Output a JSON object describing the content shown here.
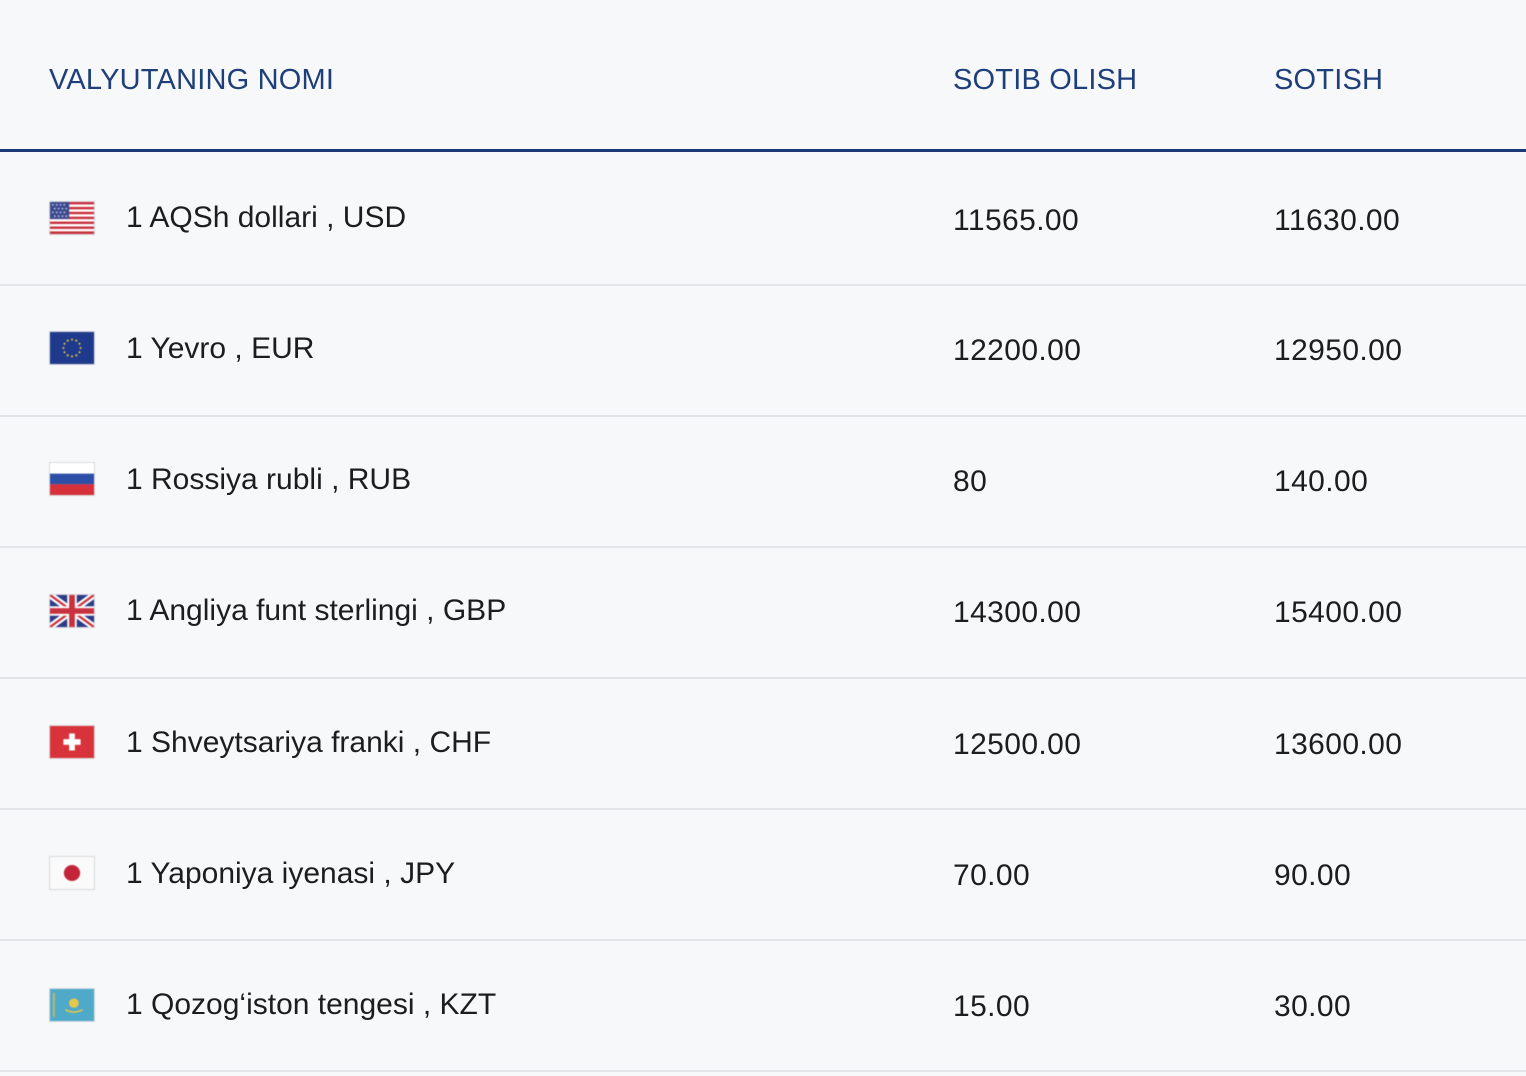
{
  "table": {
    "headers": {
      "name": "VALYUTANING NOMI",
      "buy": "SOTIB OLISH",
      "sell": "SOTISH"
    },
    "rows": [
      {
        "flag_icon": "usa-flag-icon",
        "name": "1 AQSh dollari , USD",
        "buy": "11565.00",
        "sell": "11630.00"
      },
      {
        "flag_icon": "eu-flag-icon",
        "name": "1 Yevro , EUR",
        "buy": "12200.00",
        "sell": "12950.00"
      },
      {
        "flag_icon": "russia-flag-icon",
        "name": "1 Rossiya rubli , RUB",
        "buy": "80",
        "sell": "140.00"
      },
      {
        "flag_icon": "uk-flag-icon",
        "name": "1 Angliya funt sterlingi , GBP",
        "buy": "14300.00",
        "sell": "15400.00"
      },
      {
        "flag_icon": "switzerland-flag-icon",
        "name": "1 Shveytsariya franki , CHF",
        "buy": "12500.00",
        "sell": "13600.00"
      },
      {
        "flag_icon": "japan-flag-icon",
        "name": "1 Yaponiya iyenasi , JPY",
        "buy": "70.00",
        "sell": "90.00"
      },
      {
        "flag_icon": "kazakhstan-flag-icon",
        "name": "1 Qozog‘iston tengesi , KZT",
        "buy": "15.00",
        "sell": "30.00"
      }
    ]
  },
  "colors": {
    "header_text": "#1f3f7a",
    "header_rule": "#1c3a73",
    "row_divider": "#e2e5e8",
    "background": "#f7f8f9"
  }
}
